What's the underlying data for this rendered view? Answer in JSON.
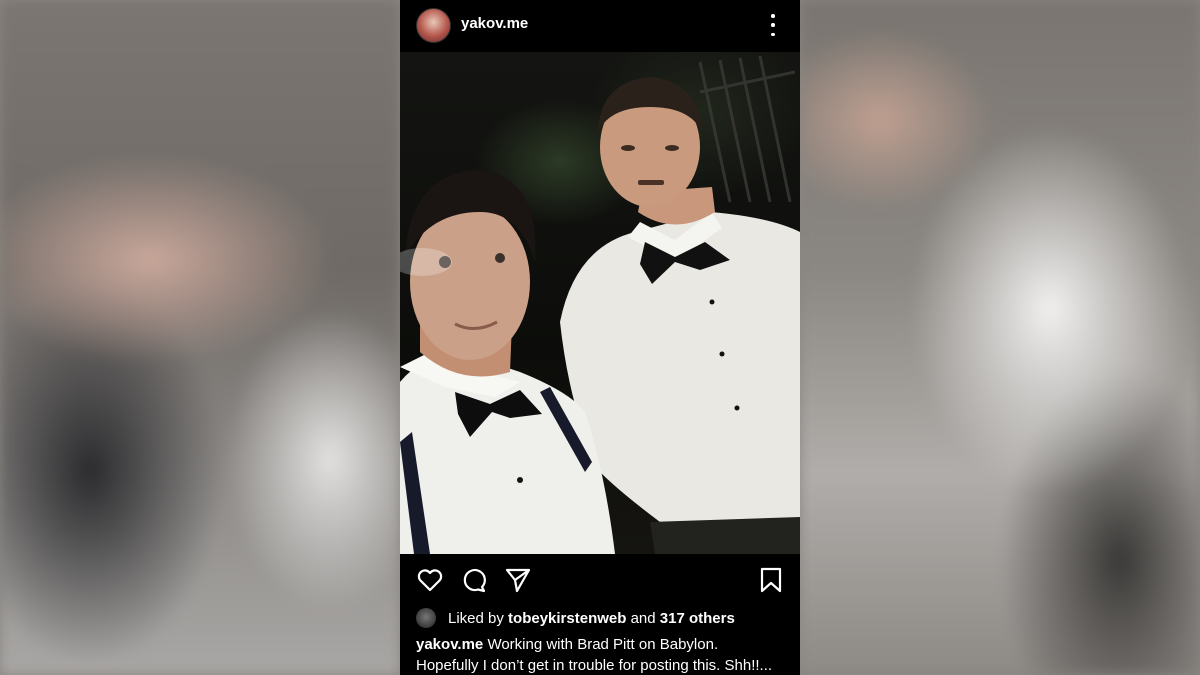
{
  "post": {
    "username": "yakov.me",
    "avatar_icon": "profile-avatar",
    "more_icon": "more-vertical-icon",
    "actions": {
      "like_icon": "heart-icon",
      "comment_icon": "comment-icon",
      "share_icon": "send-icon",
      "save_icon": "bookmark-icon"
    },
    "likes": {
      "prefix": "Liked by",
      "first_user": "tobeykirstenweb",
      "joiner": "and",
      "others": "317 others"
    },
    "caption": {
      "username": "yakov.me",
      "line1": "Working with Brad Pitt on Babylon.",
      "line2": "Hopefully I don’t get in trouble for posting this. Shh!!..."
    }
  },
  "colors": {
    "post_background": "#000000",
    "text": "#ffffff"
  }
}
